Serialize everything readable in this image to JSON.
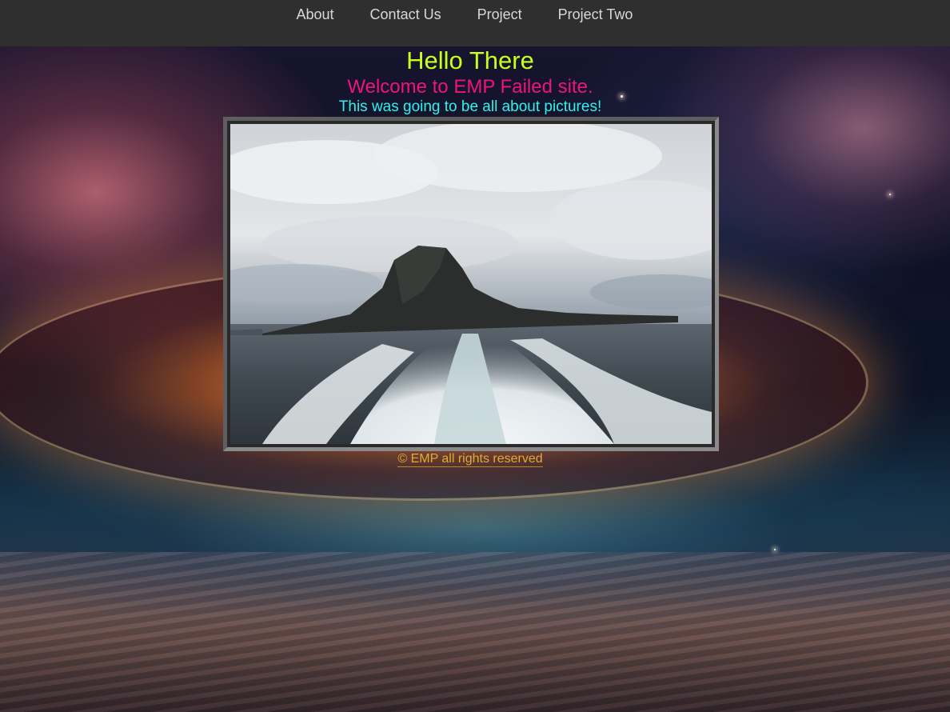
{
  "nav": {
    "items": [
      {
        "label": "About"
      },
      {
        "label": "Contact Us"
      },
      {
        "label": "Project"
      },
      {
        "label": "Project Two"
      }
    ]
  },
  "main": {
    "heading": "Hello There",
    "welcome": "Welcome to EMP Failed site.",
    "subtitle": "This was going to be all about pictures!"
  },
  "footer": {
    "text": "© EMP all rights reserved"
  },
  "colors": {
    "nav_bg": "#2f2f2f",
    "nav_text": "#d8d8d8",
    "heading": "#c8ff1e",
    "welcome": "#ec157c",
    "subtitle": "#2ff2ef",
    "footer": "#e6a935"
  }
}
